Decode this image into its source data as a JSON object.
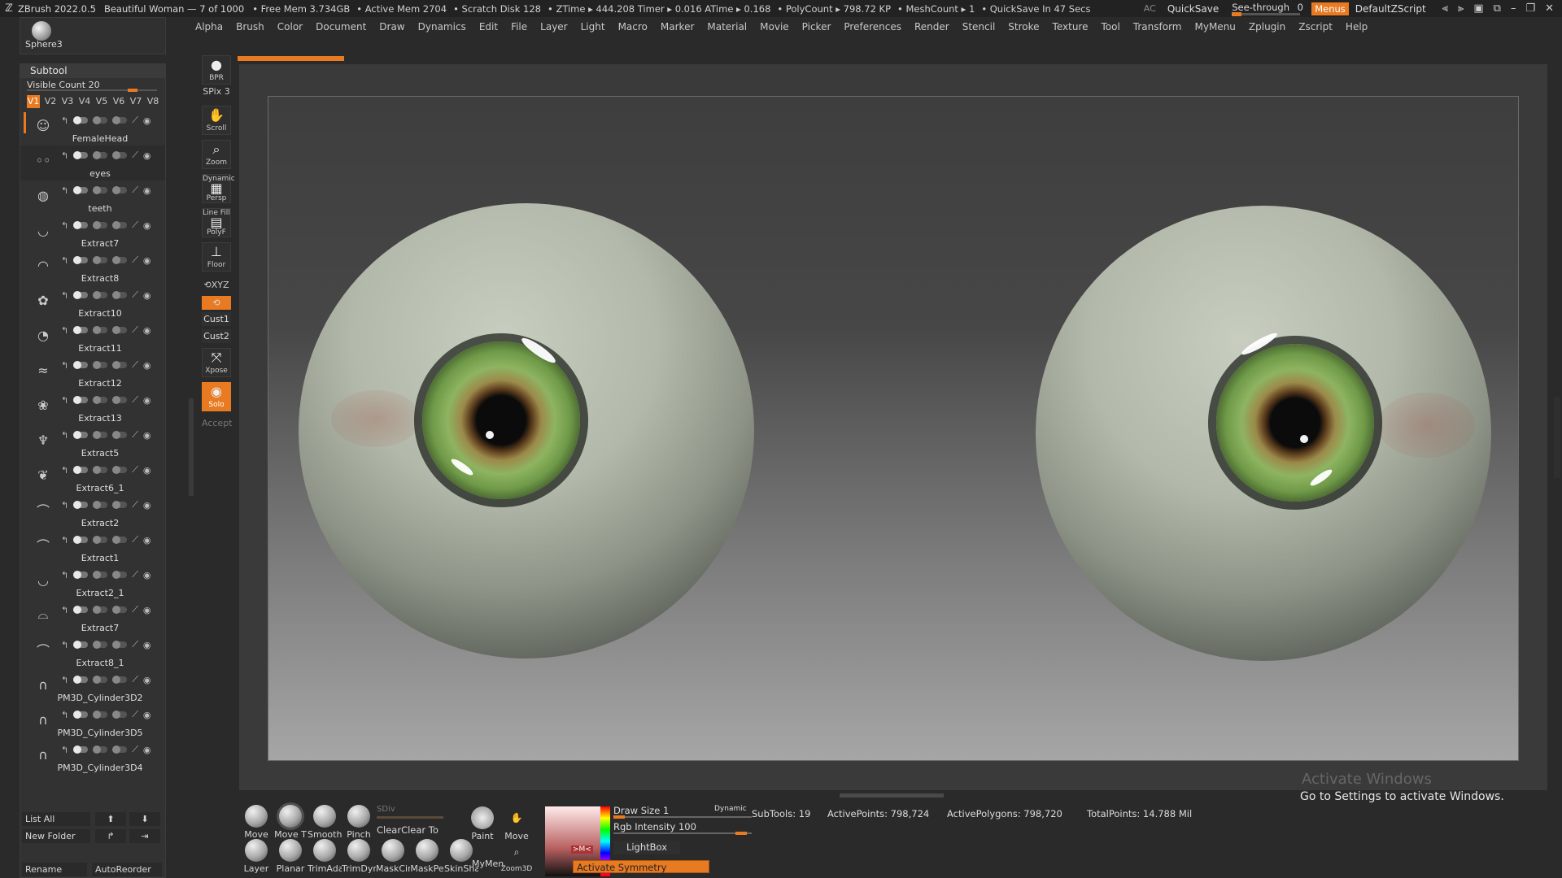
{
  "titlebar": {
    "app_version": "ZBrush 2022.0.5",
    "document": "Beautiful Woman — 7 of 1000",
    "stats": [
      "• Free Mem 3.734GB",
      "• Active Mem 2704",
      "• Scratch Disk 128",
      "• ZTime ▸ 444.208 Timer ▸ 0.016 ATime ▸ 0.168",
      "• PolyCount ▸ 798.72 KP",
      "• MeshCount ▸ 1",
      "• QuickSave In 47 Secs"
    ],
    "ac_label": "AC",
    "quicksave": "QuickSave",
    "seethrough": "See-through",
    "seethrough_value": "0",
    "menus": "Menus",
    "default_zscript": "DefaultZScript"
  },
  "menubar": {
    "items": [
      "Alpha",
      "Brush",
      "Color",
      "Document",
      "Draw",
      "Dynamics",
      "Edit",
      "File",
      "Layer",
      "Light",
      "Macro",
      "Marker",
      "Material",
      "Movie",
      "Picker",
      "Preferences",
      "Render",
      "Stencil",
      "Stroke",
      "Texture",
      "Tool",
      "Transform",
      "MyMenu",
      "Zplugin",
      "Zscript",
      "Help"
    ]
  },
  "brush_slot": {
    "label": "Sphere3"
  },
  "subtool": {
    "title": "Subtool",
    "visible_count_label": "Visible Count",
    "visible_count": "20",
    "visibility_sets": [
      "V1",
      "V2",
      "V3",
      "V4",
      "V5",
      "V6",
      "V7",
      "V8"
    ],
    "active_set": "V1",
    "items": [
      "FemaleHead",
      "eyes",
      "teeth",
      "Extract7",
      "Extract8",
      "Extract10",
      "Extract11",
      "Extract12",
      "Extract13",
      "Extract5",
      "Extract6_1",
      "Extract2",
      "Extract1",
      "Extract2_1",
      "Extract7",
      "Extract8_1",
      "PM3D_Cylinder3D2",
      "PM3D_Cylinder3D5",
      "PM3D_Cylinder3D4"
    ],
    "selected_index": 1,
    "footer": {
      "list_all": "List All",
      "new_folder": "New Folder",
      "rename": "Rename",
      "autoreorder": "AutoReorder"
    }
  },
  "shelf": {
    "bpr": "BPR",
    "spix": "SPix 3",
    "scroll": "Scroll",
    "zoom": "Zoom",
    "persp": "Persp",
    "persp_top": "Dynamic",
    "polyf": "PolyF",
    "polyf_top": "Line Fill",
    "floor": "Floor",
    "xyz": "XYZ",
    "cust1": "Cust1",
    "cust2": "Cust2",
    "xpose": "Xpose",
    "solo": "Solo",
    "accept": "Accept"
  },
  "bottom": {
    "tools_row1": [
      "Move",
      "Move T",
      "Smooth",
      "Pinch"
    ],
    "tools_row2": [
      "Layer",
      "Planar",
      "TrimAdapt",
      "TrimDyn",
      "MaskCir",
      "MaskPe",
      "SkinSha",
      "MyMenu"
    ],
    "sdiv": "SDiv",
    "clear": "ClearClear To",
    "paint": "Paint",
    "move3d": "Move",
    "zoom3d": "Zoom3D",
    "draw_size_label": "Draw Size",
    "draw_size": "1",
    "dynamic": "Dynamic",
    "rgb_label": "Rgb Intensity",
    "rgb_value": "100",
    "lightbox": "LightBox",
    "m_btn": ">M<",
    "activate_symmetry": "Activate Symmetry",
    "subtools": "SubTools: 19",
    "active_points": "ActivePoints: 798,724",
    "active_polygons": "ActivePolygons: 798,720",
    "total_points": "TotalPoints: 14.788 Mil"
  },
  "watermark": {
    "line1": "Activate Windows",
    "line2": "Go to Settings to activate Windows."
  },
  "colors": {
    "accent": "#e87a22",
    "iris_green": "#8eb461",
    "sclera": "#b3b9aa"
  }
}
